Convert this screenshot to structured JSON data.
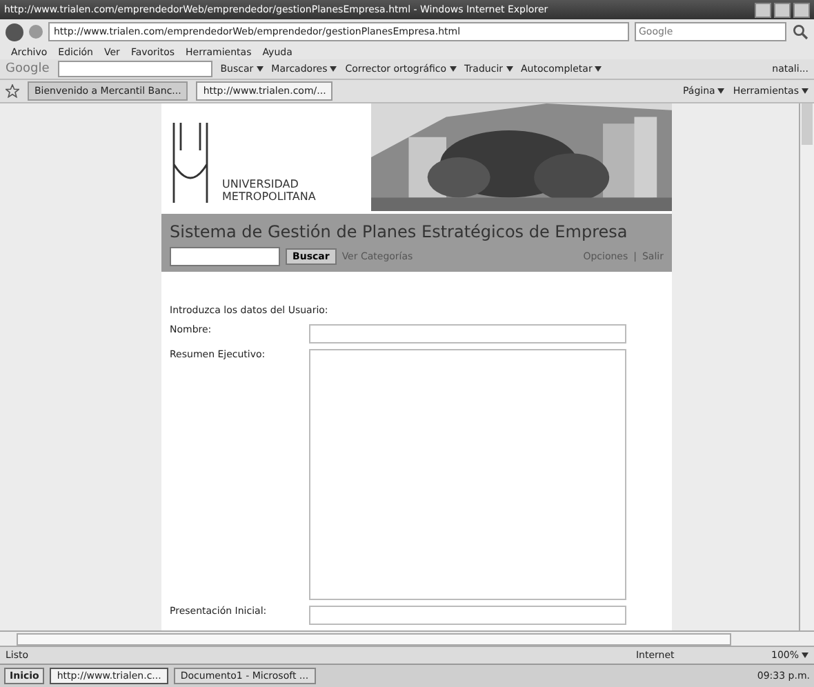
{
  "window": {
    "title": "http://www.trialen.com/emprendedorWeb/emprendedor/gestionPlanesEmpresa.html - Windows Internet Explorer"
  },
  "address_bar": {
    "url": "http://www.trialen.com/emprendedorWeb/emprendedor/gestionPlanesEmpresa.html",
    "search_placeholder": "Google"
  },
  "menu": [
    "Archivo",
    "Edición",
    "Ver",
    "Favoritos",
    "Herramientas",
    "Ayuda"
  ],
  "google_toolbar": {
    "label": "Google",
    "items": [
      "Buscar",
      "Marcadores",
      "Corrector ortográfico",
      "Traducir",
      "Autocompletar"
    ],
    "account": "natali..."
  },
  "tabs": [
    {
      "label": "Bienvenido a Mercantil Banc...",
      "selected": false
    },
    {
      "label": "http://www.trialen.com/...",
      "selected": true
    }
  ],
  "command_bar": [
    "Página",
    "Herramientas"
  ],
  "page": {
    "logo": [
      "UNIVERSIDAD",
      "METROPOLITANA"
    ],
    "banner": {
      "kind": "picture"
    },
    "title": "Sistema de Gestión de Planes Estratégicos de Empresa",
    "search_button": "Buscar",
    "link": "Ver Categorías",
    "right_links": [
      "Opciones",
      "Salir"
    ],
    "separator": "|",
    "form": {
      "heading": "Introduzca los datos del Usuario:",
      "fields": [
        {
          "label": "Nombre:",
          "kind": "input"
        },
        {
          "label": "Resumen Ejecutivo:",
          "kind": "textarea"
        },
        {
          "label": "Presentación Inicial:",
          "kind": "input"
        }
      ]
    }
  },
  "status_bar": {
    "text": "Listo",
    "zone": "Internet",
    "zoom": "100%"
  },
  "taskbar": {
    "start": "Inicio",
    "windows": [
      {
        "label": "http://www.trialen.c...",
        "selected": true
      },
      {
        "label": "Documento1 - Microsoft ...",
        "selected": false
      }
    ],
    "clock": "09:33 p.m."
  }
}
